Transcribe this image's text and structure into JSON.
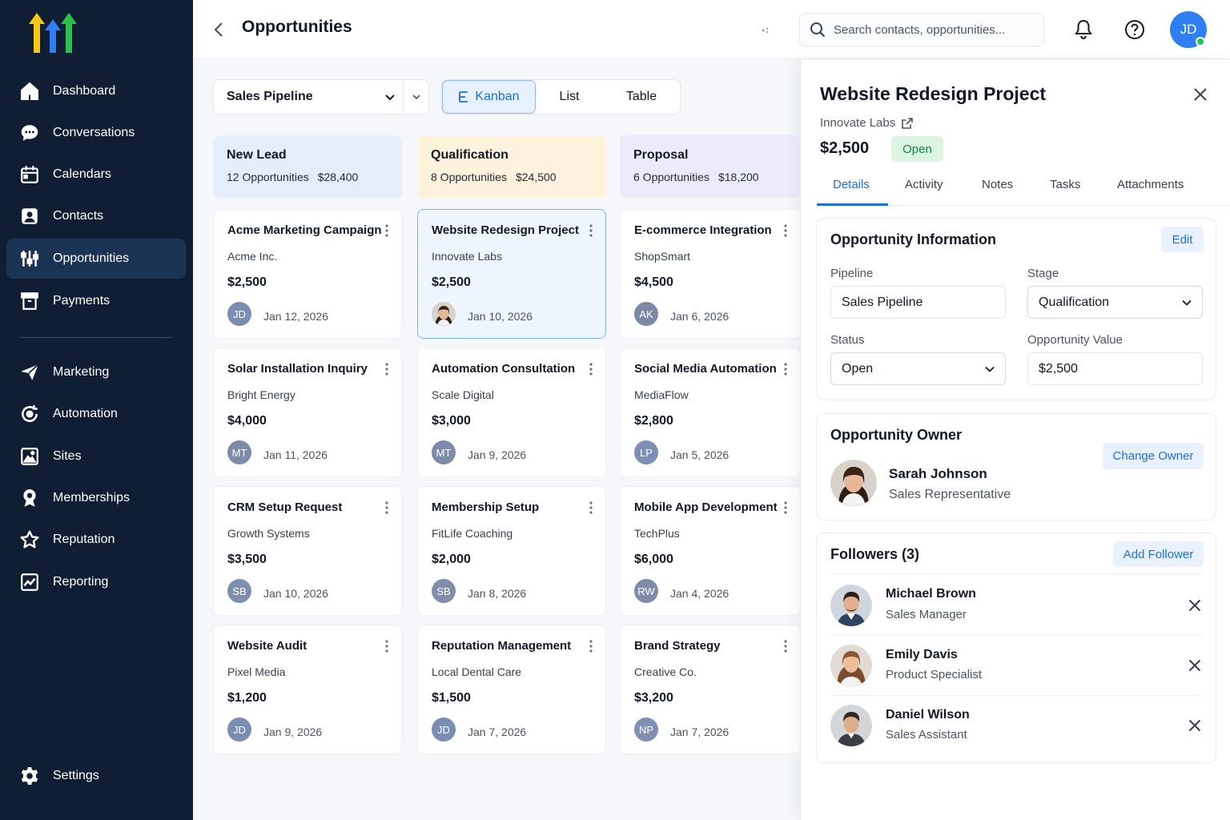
{
  "sidebar": {
    "items": [
      {
        "label": "Dashboard",
        "icon": "home-icon"
      },
      {
        "label": "Conversations",
        "icon": "chat-icon"
      },
      {
        "label": "Calendars",
        "icon": "calendar-icon"
      },
      {
        "label": "Contacts",
        "icon": "contacts-icon"
      },
      {
        "label": "Opportunities",
        "icon": "sliders-icon",
        "active": true
      },
      {
        "label": "Payments",
        "icon": "archive-icon"
      },
      {
        "label": "Marketing",
        "icon": "send-icon"
      },
      {
        "label": "Automation",
        "icon": "automation-icon"
      },
      {
        "label": "Sites",
        "icon": "image-icon"
      },
      {
        "label": "Memberships",
        "icon": "badge-icon"
      },
      {
        "label": "Reputation",
        "icon": "star-icon"
      },
      {
        "label": "Reporting",
        "icon": "chart-icon"
      }
    ],
    "settings_label": "Settings"
  },
  "header": {
    "title": "Opportunities",
    "search_placeholder": "Search contacts, opportunities...",
    "avatar_initials": "JD"
  },
  "toolbar": {
    "pipeline": "Sales Pipeline",
    "views": [
      "Kanban",
      "List",
      "Table"
    ],
    "active_view": "Kanban"
  },
  "columns": [
    {
      "title": "New Lead",
      "count": "12 Opportunities",
      "total": "$28,400",
      "color": "#e4eefb",
      "cards": [
        {
          "title": "Acme Marketing Campaign",
          "company": "Acme Inc.",
          "amount": "$2,500",
          "initials": "JD",
          "date": "Jan 12, 2026"
        },
        {
          "title": "Solar Installation Inquiry",
          "company": "Bright Energy",
          "amount": "$4,000",
          "initials": "MT",
          "date": "Jan 11, 2026"
        },
        {
          "title": "CRM Setup Request",
          "company": "Growth Systems",
          "amount": "$3,500",
          "initials": "SB",
          "date": "Jan 10, 2026"
        },
        {
          "title": "Website Audit",
          "company": "Pixel Media",
          "amount": "$1,200",
          "initials": "JD",
          "date": "Jan 9, 2026"
        }
      ]
    },
    {
      "title": "Qualification",
      "count": "8 Opportunities",
      "total": "$24,500",
      "color": "#fdf3dc",
      "cards": [
        {
          "title": "Website Redesign Project",
          "company": "Innovate Labs",
          "amount": "$2,500",
          "initials": "",
          "date": "Jan 10, 2026"
        },
        {
          "title": "Automation Consultation",
          "company": "Scale Digital",
          "amount": "$3,000",
          "initials": "MT",
          "date": "Jan 9, 2026"
        },
        {
          "title": "Membership Setup",
          "company": "FitLife Coaching",
          "amount": "$2,000",
          "initials": "SB",
          "date": "Jan 8, 2026"
        },
        {
          "title": "Reputation Management",
          "company": "Local Dental Care",
          "amount": "$1,500",
          "initials": "JD",
          "date": "Jan 7, 2026"
        }
      ]
    },
    {
      "title": "Proposal",
      "count": "6 Opportunities",
      "total": "$18,200",
      "color": "#ecebfa",
      "cards": [
        {
          "title": "E-commerce Integration",
          "company": "ShopSmart",
          "amount": "$4,500",
          "initials": "AK",
          "date": "Jan 6, 2026"
        },
        {
          "title": "Social Media Automation",
          "company": "MediaFlow",
          "amount": "$2,800",
          "initials": "LP",
          "date": "Jan 5, 2026"
        },
        {
          "title": "Mobile App Development",
          "company": "TechPlus",
          "amount": "$6,000",
          "initials": "RW",
          "date": "Jan 4, 2026"
        },
        {
          "title": "Brand Strategy",
          "company": "Creative Co.",
          "amount": "$3,200",
          "initials": "NP",
          "date": "Jan 7, 2026"
        }
      ]
    }
  ],
  "detail": {
    "title": "Website Redesign Project",
    "company": "Innovate Labs",
    "amount": "$2,500",
    "status_badge": "Open",
    "tabs": [
      "Details",
      "Activity",
      "Notes",
      "Tasks",
      "Attachments"
    ],
    "info": {
      "title": "Opportunity Information",
      "edit_label": "Edit",
      "pipeline_label": "Pipeline",
      "pipeline_value": "Sales Pipeline",
      "stage_label": "Stage",
      "stage_value": "Qualification",
      "status_label": "Status",
      "status_value": "Open",
      "value_label": "Opportunity Value",
      "value_value": "$2,500"
    },
    "owner": {
      "title": "Opportunity Owner",
      "change_label": "Change Owner",
      "name": "Sarah Johnson",
      "role": "Sales Representative"
    },
    "followers": {
      "title": "Followers (3)",
      "add_label": "Add Follower",
      "list": [
        {
          "name": "Michael Brown",
          "role": "Sales Manager"
        },
        {
          "name": "Emily Davis",
          "role": "Product Specialist"
        },
        {
          "name": "Daniel Wilson",
          "role": "Sales Assistant"
        }
      ]
    }
  },
  "colors": {
    "sidebar_bg": "#0f1e33",
    "accent": "#1f6fe0",
    "open_badge": "#dcf5e3",
    "online": "#22c55e"
  }
}
